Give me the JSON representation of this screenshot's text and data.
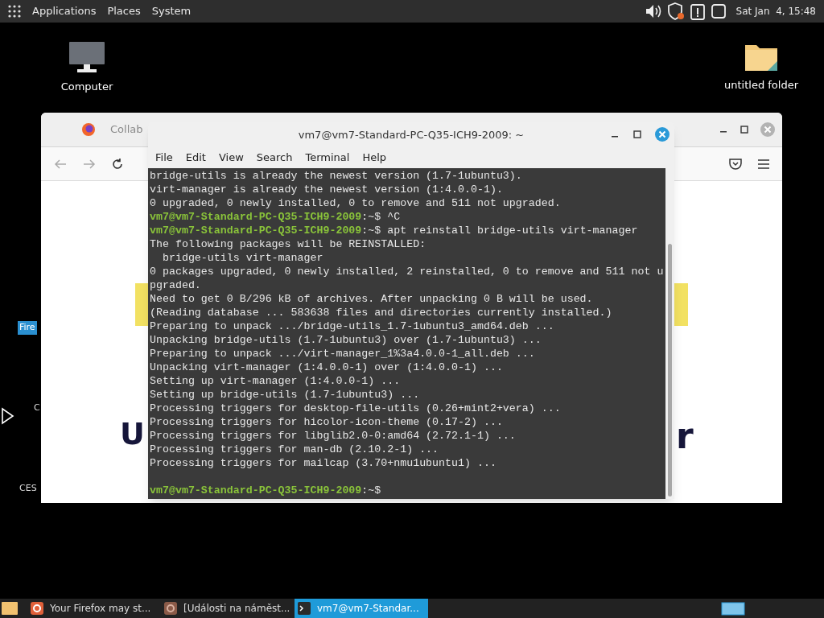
{
  "top_panel": {
    "menus": [
      "Applications",
      "Places",
      "System"
    ],
    "clock": "Sat Jan  4, 15:48"
  },
  "desktop_icons": [
    {
      "label": "Computer",
      "kind": "computer"
    },
    {
      "label": "untitled folder",
      "kind": "folder"
    }
  ],
  "desktop_fragments": [
    {
      "text": "Fire",
      "selected": true
    },
    {
      "text": "C",
      "selected": false
    },
    {
      "text": "CES",
      "selected": false
    }
  ],
  "browser": {
    "tab_title": "Collab",
    "page_fragments": [
      "U",
      "r"
    ]
  },
  "terminal": {
    "title": "vm7@vm7-Standard-PC-Q35-ICH9-2009: ~",
    "menus": [
      "File",
      "Edit",
      "View",
      "Search",
      "Terminal",
      "Help"
    ],
    "lines": [
      {
        "kind": "output",
        "text": "bridge-utils is already the newest version (1.7-1ubuntu3)."
      },
      {
        "kind": "output",
        "text": "virt-manager is already the newest version (1:4.0.0-1)."
      },
      {
        "kind": "output",
        "text": "0 upgraded, 0 newly installed, 0 to remove and 511 not upgraded."
      },
      {
        "kind": "prompt",
        "user": "vm7@vm7-Standard-PC-Q35-ICH9-2009",
        "text": ":~$ ^C"
      },
      {
        "kind": "prompt",
        "user": "vm7@vm7-Standard-PC-Q35-ICH9-2009",
        "text": ":~$ apt reinstall bridge-utils virt-manager"
      },
      {
        "kind": "output",
        "text": "The following packages will be REINSTALLED:"
      },
      {
        "kind": "output",
        "text": "  bridge-utils virt-manager"
      },
      {
        "kind": "output",
        "text": "0 packages upgraded, 0 newly installed, 2 reinstalled, 0 to remove and 511 not u"
      },
      {
        "kind": "output",
        "text": "pgraded."
      },
      {
        "kind": "output",
        "text": "Need to get 0 B/296 kB of archives. After unpacking 0 B will be used."
      },
      {
        "kind": "output",
        "text": "(Reading database ... 583638 files and directories currently installed.)"
      },
      {
        "kind": "output",
        "text": "Preparing to unpack .../bridge-utils_1.7-1ubuntu3_amd64.deb ..."
      },
      {
        "kind": "output",
        "text": "Unpacking bridge-utils (1.7-1ubuntu3) over (1.7-1ubuntu3) ..."
      },
      {
        "kind": "output",
        "text": "Preparing to unpack .../virt-manager_1%3a4.0.0-1_all.deb ..."
      },
      {
        "kind": "output",
        "text": "Unpacking virt-manager (1:4.0.0-1) over (1:4.0.0-1) ..."
      },
      {
        "kind": "output",
        "text": "Setting up virt-manager (1:4.0.0-1) ..."
      },
      {
        "kind": "output",
        "text": "Setting up bridge-utils (1.7-1ubuntu3) ..."
      },
      {
        "kind": "output",
        "text": "Processing triggers for desktop-file-utils (0.26+mint2+vera) ..."
      },
      {
        "kind": "output",
        "text": "Processing triggers for hicolor-icon-theme (0.17-2) ..."
      },
      {
        "kind": "output",
        "text": "Processing triggers for libglib2.0-0:amd64 (2.72.1-1) ..."
      },
      {
        "kind": "output",
        "text": "Processing triggers for man-db (2.10.2-1) ..."
      },
      {
        "kind": "output",
        "text": "Processing triggers for mailcap (3.70+nmu1ubuntu1) ..."
      },
      {
        "kind": "blank"
      },
      {
        "kind": "prompt",
        "user": "vm7@vm7-Standard-PC-Q35-ICH9-2009",
        "text": ":~$"
      }
    ]
  },
  "taskbar": {
    "tasks": [
      {
        "label": "Your Firefox may st...",
        "kind": "firefox",
        "selected": false
      },
      {
        "label": "[Události na náměst...",
        "kind": "media",
        "selected": false
      },
      {
        "label": "vm7@vm7-Standar...",
        "kind": "terminal",
        "selected": true
      }
    ]
  }
}
